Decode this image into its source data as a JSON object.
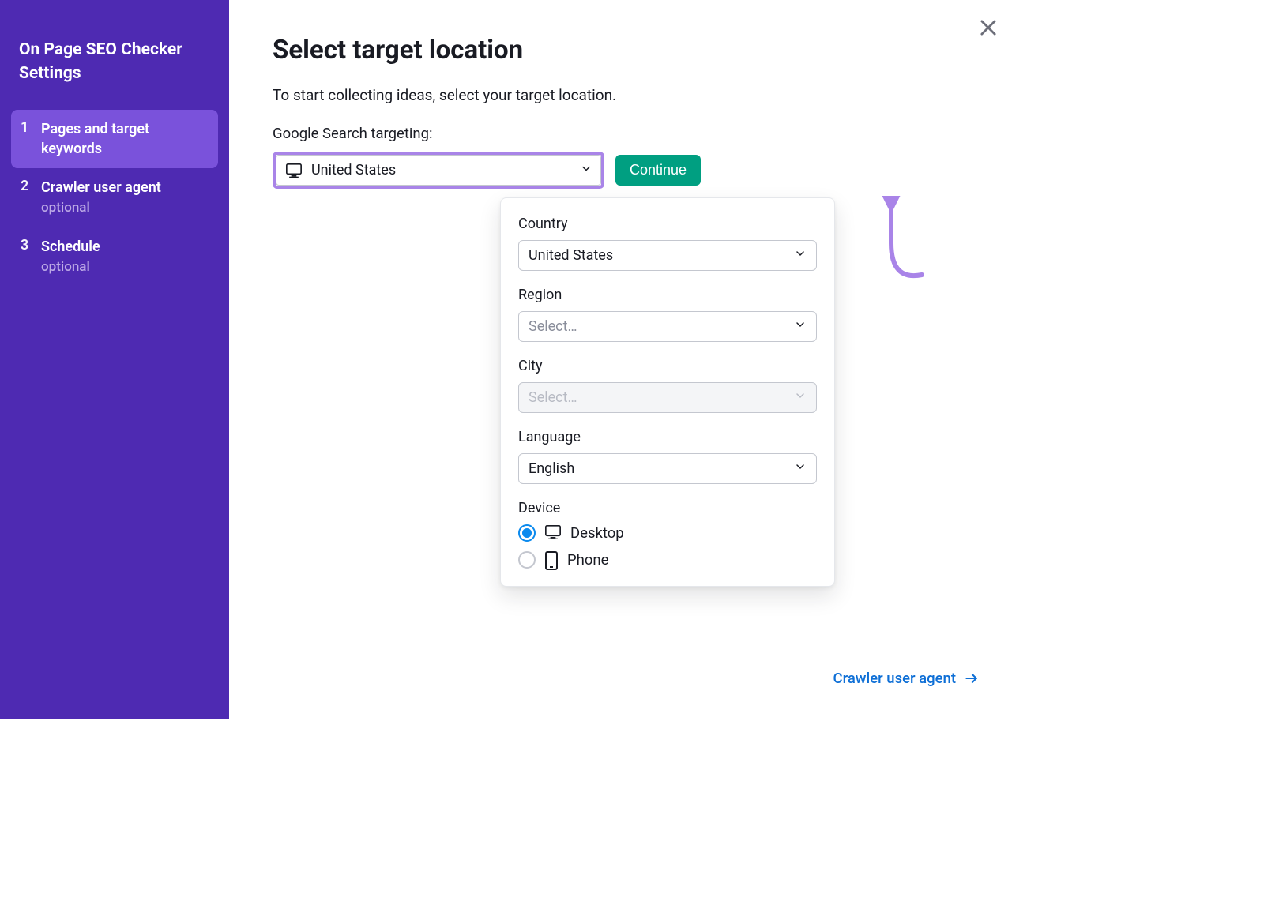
{
  "sidebar": {
    "title": "On Page SEO Checker Settings",
    "steps": [
      {
        "num": "1",
        "label": "Pages and target keywords",
        "optional": ""
      },
      {
        "num": "2",
        "label": "Crawler user agent",
        "optional": "optional"
      },
      {
        "num": "3",
        "label": "Schedule",
        "optional": "optional"
      }
    ]
  },
  "page": {
    "title": "Select target location",
    "subtitle": "To start collecting ideas, select your target location.",
    "targeting_label": "Google Search targeting:",
    "target_value": "United States",
    "continue_label": "Continue"
  },
  "dropdown": {
    "country": {
      "label": "Country",
      "value": "United States"
    },
    "region": {
      "label": "Region",
      "placeholder": "Select…"
    },
    "city": {
      "label": "City",
      "placeholder": "Select…"
    },
    "language": {
      "label": "Language",
      "value": "English"
    },
    "device": {
      "label": "Device",
      "options": [
        {
          "label": "Desktop",
          "checked": true
        },
        {
          "label": "Phone",
          "checked": false
        }
      ]
    }
  },
  "bottom_link": {
    "label": "Crawler user agent"
  }
}
